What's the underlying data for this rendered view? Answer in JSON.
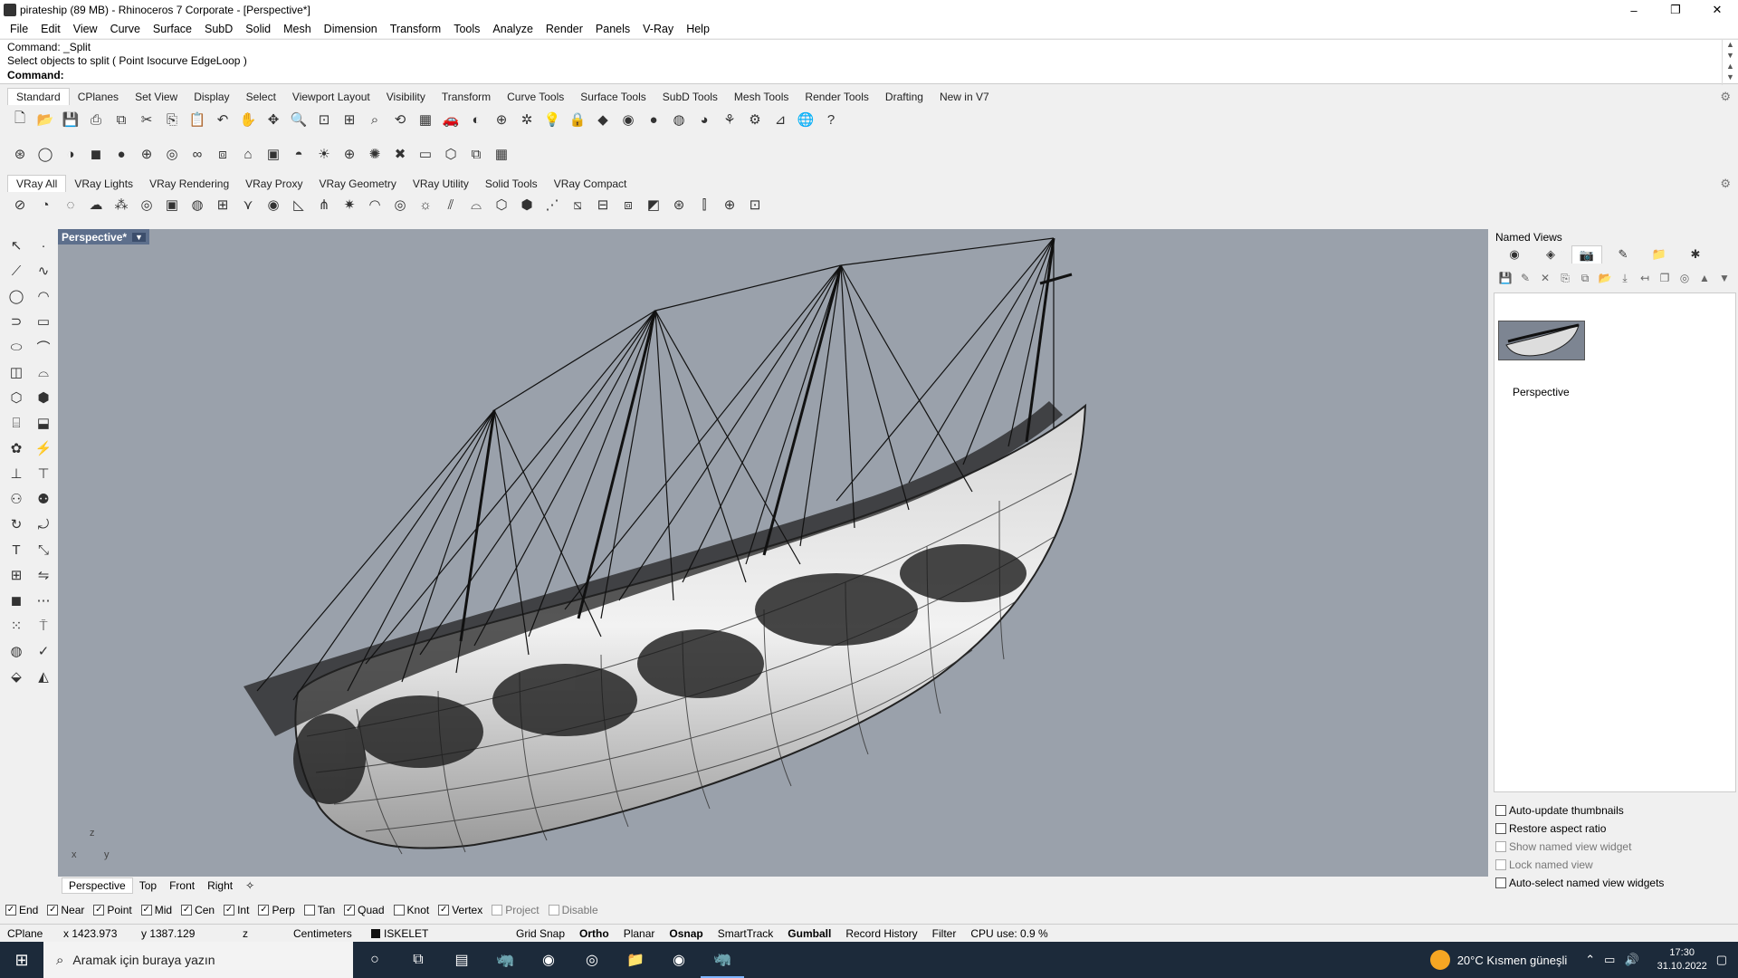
{
  "window": {
    "title": "pirateship (89 MB) - Rhinoceros 7 Corporate - [Perspective*]",
    "minimize": "–",
    "restore": "❐",
    "close": "✕"
  },
  "menu": [
    "File",
    "Edit",
    "View",
    "Curve",
    "Surface",
    "SubD",
    "Solid",
    "Mesh",
    "Dimension",
    "Transform",
    "Tools",
    "Analyze",
    "Render",
    "Panels",
    "V-Ray",
    "Help"
  ],
  "command": {
    "line1": "Command: _Split",
    "line2": "Select objects to split ( Point  Isocurve  EdgeLoop )",
    "prompt": "Command:",
    "value": ""
  },
  "toolbar_tabs": [
    "Standard",
    "CPlanes",
    "Set View",
    "Display",
    "Select",
    "Viewport Layout",
    "Visibility",
    "Transform",
    "Curve Tools",
    "Surface Tools",
    "SubD Tools",
    "Mesh Tools",
    "Render Tools",
    "Drafting",
    "New in V7"
  ],
  "toolbar_tabs_active": "Standard",
  "vray_tabs": [
    "VRay All",
    "VRay Lights",
    "VRay Rendering",
    "VRay Proxy",
    "VRay Geometry",
    "VRay Utility",
    "Solid Tools",
    "VRay Compact"
  ],
  "vray_tabs_active": "VRay All",
  "viewport": {
    "name": "Perspective*",
    "dropdown": "▼",
    "axis_z": "z",
    "axis_x": "x",
    "axis_y": "y"
  },
  "viewport_tabs": [
    "Perspective",
    "Top",
    "Front",
    "Right"
  ],
  "viewport_tabs_active": "Perspective",
  "viewport_tab_add": "✧",
  "osnaps": [
    {
      "label": "End",
      "checked": true
    },
    {
      "label": "Near",
      "checked": true
    },
    {
      "label": "Point",
      "checked": true
    },
    {
      "label": "Mid",
      "checked": true
    },
    {
      "label": "Cen",
      "checked": true
    },
    {
      "label": "Int",
      "checked": true
    },
    {
      "label": "Perp",
      "checked": true
    },
    {
      "label": "Tan",
      "checked": false
    },
    {
      "label": "Quad",
      "checked": true
    },
    {
      "label": "Knot",
      "checked": false
    },
    {
      "label": "Vertex",
      "checked": true
    },
    {
      "label": "Project",
      "checked": false,
      "dim": true
    },
    {
      "label": "Disable",
      "checked": false,
      "dim": true
    }
  ],
  "status": {
    "cplane": "CPlane",
    "x": "x 1423.973",
    "y": "y 1387.129",
    "z": "z",
    "units": "Centimeters",
    "layer": "ISKELET",
    "grid_snap": "Grid Snap",
    "ortho": "Ortho",
    "planar": "Planar",
    "osnap": "Osnap",
    "smarttrack": "SmartTrack",
    "gumball": "Gumball",
    "record_history": "Record History",
    "filter": "Filter",
    "cpu": "CPU use: 0.9 %"
  },
  "named_views": {
    "header": "Named Views",
    "thumb_label": "Perspective",
    "options": [
      {
        "label": "Auto-update thumbnails",
        "checked": false,
        "dim": false
      },
      {
        "label": "Restore aspect ratio",
        "checked": false,
        "dim": false
      },
      {
        "label": "Show named view widget",
        "checked": false,
        "dim": true
      },
      {
        "label": "Lock named view",
        "checked": false,
        "dim": true
      },
      {
        "label": "Auto-select named view widgets",
        "checked": false,
        "dim": false
      }
    ]
  },
  "taskbar": {
    "search_placeholder": "Aramak için buraya yazın",
    "weather": "20°C  Kısmen güneşli",
    "time": "17:30",
    "date": "31.10.2022"
  },
  "colors": {
    "viewport_bg": "#9aa1ab",
    "viewport_title": "#5d6f8c",
    "taskbar": "#1c2a3a"
  }
}
